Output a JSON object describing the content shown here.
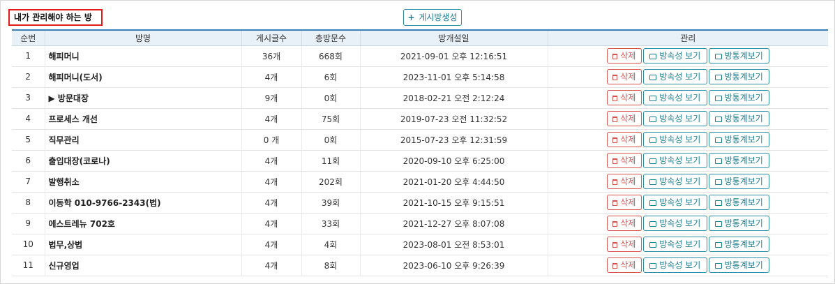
{
  "page_title": "내가 관리해야 하는 방",
  "create_button": {
    "icon": "plus-icon",
    "label": "게시방생성"
  },
  "table": {
    "headers": [
      "순번",
      "방명",
      "게시글수",
      "총방문수",
      "방개설일",
      "관리"
    ],
    "action_labels": {
      "delete": "삭제",
      "view_info": "방속성 보기",
      "view_stats": "방통계보기"
    },
    "rows": [
      {
        "no": "1",
        "name": "해피머니",
        "posts": "36개",
        "visits": "668회",
        "created": "2021-09-01 오후 12:16:51"
      },
      {
        "no": "2",
        "name": "해피머니(도서)",
        "posts": "4개",
        "visits": "6회",
        "created": "2023-11-01 오후 5:14:58"
      },
      {
        "no": "3",
        "name": "▶ 방문대장",
        "posts": "9개",
        "visits": "0회",
        "created": "2018-02-21 오전 2:12:24"
      },
      {
        "no": "4",
        "name": "프로세스 개선",
        "posts": "4개",
        "visits": "75회",
        "created": "2019-07-23 오전 11:32:52"
      },
      {
        "no": "5",
        "name": "직무관리",
        "posts": "0 개",
        "visits": "0회",
        "created": "2015-07-23 오후 12:31:59"
      },
      {
        "no": "6",
        "name": "출입대장(코로나)",
        "posts": "4개",
        "visits": "11회",
        "created": "2020-09-10 오후 6:25:00"
      },
      {
        "no": "7",
        "name": "발행취소",
        "posts": "4개",
        "visits": "202회",
        "created": "2021-01-20 오후 4:44:50"
      },
      {
        "no": "8",
        "name": "이동학 010-9766-2343(법)",
        "posts": "4개",
        "visits": "39회",
        "created": "2021-10-15 오후 9:15:51"
      },
      {
        "no": "9",
        "name": "에스트레뉴 702호",
        "posts": "4개",
        "visits": "33회",
        "created": "2021-12-27 오후 8:07:08"
      },
      {
        "no": "10",
        "name": "법무,상법",
        "posts": "4개",
        "visits": "4회",
        "created": "2023-08-01 오전 8:53:01"
      },
      {
        "no": "11",
        "name": "신규영업",
        "posts": "4개",
        "visits": "8회",
        "created": "2023-06-10 오후 9:26:39"
      }
    ]
  },
  "colors": {
    "title_border": "#e31b1b",
    "header_bg": "#e8f1f8",
    "header_top_border": "#3c7fb2",
    "delete_accent": "#d9534f",
    "action_accent": "#1f7f92"
  }
}
